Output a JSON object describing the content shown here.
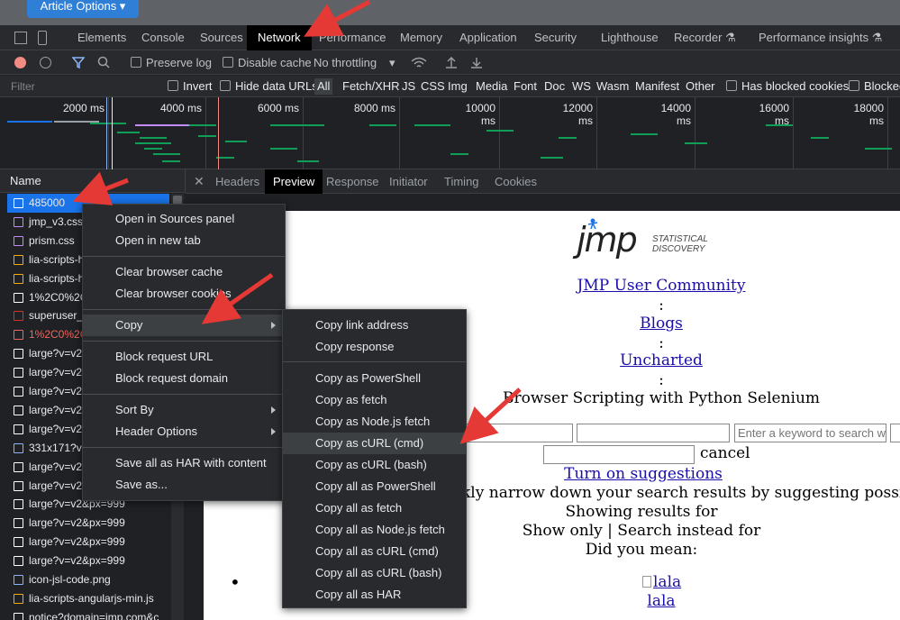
{
  "page_strip": {
    "article_options": "Article Options ▾"
  },
  "devtools_tabs": [
    "Elements",
    "Console",
    "Sources",
    "Network",
    "Performance",
    "Memory",
    "Application",
    "Security",
    "Lighthouse",
    "Recorder ⚗",
    "Performance insights ⚗"
  ],
  "network_toolbar": {
    "preserve_log": "Preserve log",
    "disable_cache": "Disable cache",
    "throttling": "No throttling"
  },
  "filter_bar": {
    "placeholder": "Filter",
    "invert": "Invert",
    "hide_data_urls": "Hide data URLs",
    "types": [
      "All",
      "Fetch/XHR",
      "JS",
      "CSS",
      "Img",
      "Media",
      "Font",
      "Doc",
      "WS",
      "Wasm",
      "Manifest",
      "Other"
    ],
    "has_blocked_cookies": "Has blocked cookies",
    "blocked": "Blocked"
  },
  "timeline_ticks": [
    "2000 ms",
    "4000 ms",
    "6000 ms",
    "8000 ms",
    "10000 ms",
    "12000 ms",
    "14000 ms",
    "16000 ms",
    "18000 ms"
  ],
  "name_column": {
    "header": "Name",
    "rows": [
      {
        "name": "485000",
        "icon": "doc-icon",
        "color": "#ffffff"
      },
      {
        "name": "jmp_v3.css",
        "icon": "css-icon",
        "color": "#c58af9"
      },
      {
        "name": "prism.css",
        "icon": "css-icon",
        "color": "#c58af9"
      },
      {
        "name": "lia-scripts-h",
        "icon": "script-icon",
        "color": "#f9ab00"
      },
      {
        "name": "lia-scripts-h",
        "icon": "script-icon",
        "color": "#f9ab00"
      },
      {
        "name": "1%2C0%2C",
        "icon": "doc-icon",
        "color": "#ffffff"
      },
      {
        "name": "superuser_r",
        "icon": "img-icon",
        "color": "#d93025"
      },
      {
        "name": "1%2C0%2C",
        "icon": "doc-icon",
        "color": "#ee675c"
      },
      {
        "name": "large?v=v2",
        "icon": "img-icon",
        "color": "#ffffff"
      },
      {
        "name": "large?v=v2",
        "icon": "img-icon",
        "color": "#ffffff"
      },
      {
        "name": "large?v=v2",
        "icon": "img-icon",
        "color": "#ffffff"
      },
      {
        "name": "large?v=v2",
        "icon": "img-icon",
        "color": "#ffffff"
      },
      {
        "name": "large?v=v2",
        "icon": "img-icon",
        "color": "#ffffff"
      },
      {
        "name": "331x171?v=",
        "icon": "img-icon",
        "color": "#8ab4f8"
      },
      {
        "name": "large?v=v2",
        "icon": "img-icon",
        "color": "#ffffff"
      },
      {
        "name": "large?v=v2",
        "icon": "img-icon",
        "color": "#ffffff"
      },
      {
        "name": "large?v=v2&px=999",
        "icon": "img-icon",
        "color": "#ffffff"
      },
      {
        "name": "large?v=v2&px=999",
        "icon": "img-icon",
        "color": "#ffffff"
      },
      {
        "name": "large?v=v2&px=999",
        "icon": "img-icon",
        "color": "#ffffff"
      },
      {
        "name": "large?v=v2&px=999",
        "icon": "img-icon",
        "color": "#ffffff"
      },
      {
        "name": "icon-jsl-code.png",
        "icon": "img-icon",
        "color": "#8ab4f8"
      },
      {
        "name": "lia-scripts-angularjs-min.js",
        "icon": "script-icon",
        "color": "#f9ab00"
      },
      {
        "name": "notice?domain=jmp.com&c",
        "icon": "doc-icon",
        "color": "#ffffff"
      }
    ]
  },
  "detail_tabs": [
    "Headers",
    "Preview",
    "Response",
    "Initiator",
    "Timing",
    "Cookies"
  ],
  "preview": {
    "logo_text": "jmp",
    "logo_tag1": "STATISTICAL",
    "logo_tag2": "DISCOVERY",
    "community_link": "JMP User Community",
    "colon": ":",
    "blogs_link": "Blogs",
    "uncharted_link": "Uncharted",
    "article_title": "Browser Scripting with Python Selenium",
    "search_placeholder": "Enter a keyword to search w",
    "cancel": "cancel",
    "suggestions_link": "Turn on suggestions",
    "narrow_text": "kly narrow down your search results by suggesting possible mat",
    "showing_results": "Showing results for",
    "show_only": "Show  only  | Search instead for",
    "did_you_mean": "Did you mean:",
    "img_alt": "lala",
    "img_caption": "lala"
  },
  "context_menu": {
    "items": [
      "Open in Sources panel",
      "Open in new tab",
      "Clear browser cache",
      "Clear browser cookies",
      "Copy",
      "Block request URL",
      "Block request domain",
      "Sort By",
      "Header Options",
      "Save all as HAR with content",
      "Save as..."
    ]
  },
  "copy_submenu": {
    "items": [
      "Copy link address",
      "Copy response",
      "Copy as PowerShell",
      "Copy as fetch",
      "Copy as Node.js fetch",
      "Copy as cURL (cmd)",
      "Copy as cURL (bash)",
      "Copy all as PowerShell",
      "Copy all as fetch",
      "Copy all as Node.js fetch",
      "Copy all as cURL (cmd)",
      "Copy all as cURL (bash)",
      "Copy all as HAR"
    ],
    "highlighted": "Copy as cURL (cmd)"
  },
  "colors": {
    "accent_red": "#e53935",
    "selected_row": "#1a73e8",
    "link": "#1a0dab",
    "recording": "#f28b82"
  }
}
